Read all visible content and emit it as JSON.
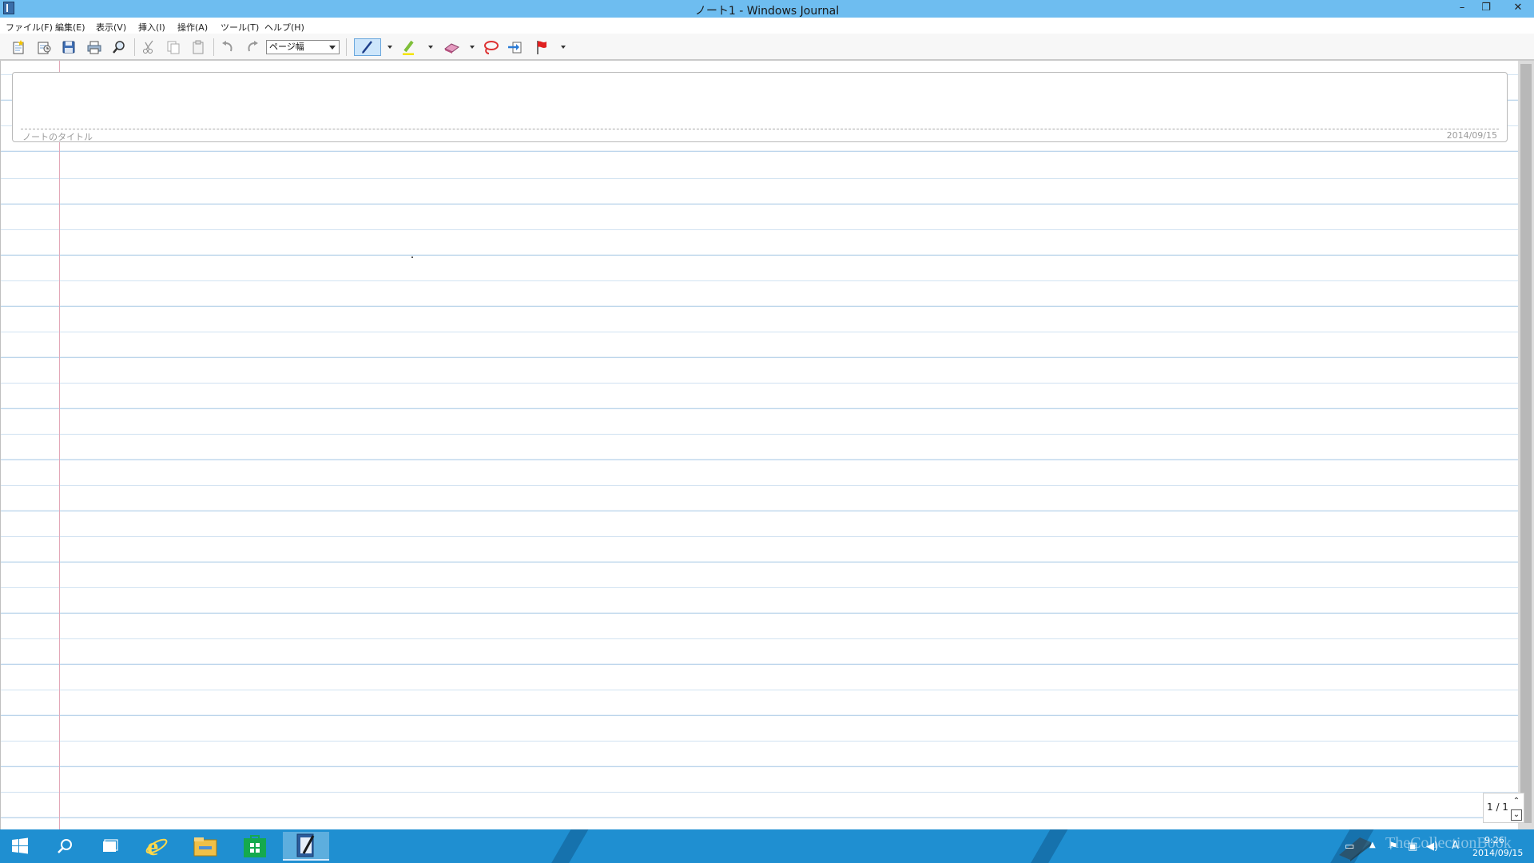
{
  "window": {
    "title": "ノート1 - Windows Journal",
    "minimize_glyph": "–",
    "maximize_glyph": "❐",
    "close_glyph": "✕"
  },
  "menu": {
    "items": [
      "ファイル(F)",
      "編集(E)",
      "表示(V)",
      "挿入(I)",
      "操作(A)",
      "ツール(T)",
      "ヘルプ(H)"
    ]
  },
  "toolbar": {
    "zoom_value": "ページ幅",
    "icons": [
      "new-note-icon",
      "open-note-icon",
      "save-icon",
      "print-icon",
      "find-icon",
      "cut-icon",
      "copy-icon",
      "paste-icon",
      "undo-icon",
      "redo-icon",
      "pen-icon",
      "highlighter-icon",
      "eraser-icon",
      "lasso-select-icon",
      "insert-space-icon",
      "flag-icon"
    ]
  },
  "note": {
    "title_placeholder": "ノートのタイトル",
    "date": "2014/09/15"
  },
  "page_navigator": {
    "text": "1 / 1"
  },
  "taskbar": {
    "apps": [
      "start-icon",
      "search-icon",
      "task-view-icon",
      "internet-explorer-icon",
      "file-explorer-icon",
      "store-icon",
      "windows-journal-icon"
    ],
    "clock_time": "9:26",
    "clock_date": "2014/09/15",
    "ime_label": "A",
    "watermark": "TheCollectionBook"
  },
  "colors": {
    "titlebar": "#6ebdf0",
    "taskbar": "#1f8fd1",
    "rule_lines": "#b9d3ea",
    "margin_line": "#e3a8b8"
  }
}
